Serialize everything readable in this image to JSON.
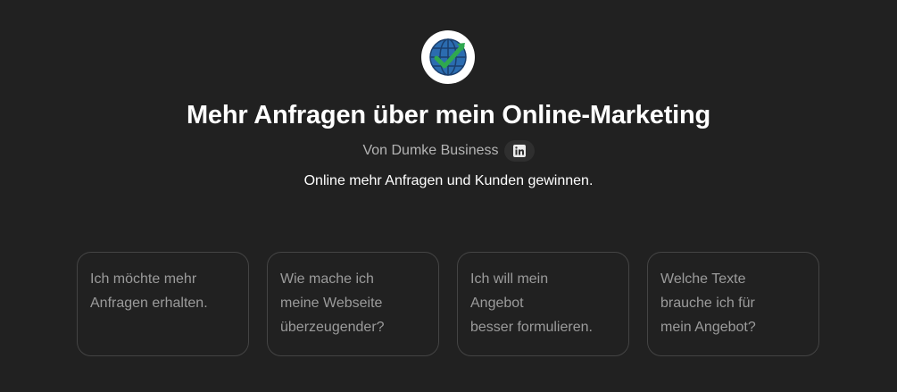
{
  "logo": {
    "icon": "globe-checkmark-icon",
    "colors": {
      "globe": "#2b6cb0",
      "check": "#2fa84f",
      "background": "#ffffff"
    }
  },
  "header": {
    "title": "Mehr Anfragen über mein Online-Marketing",
    "byline": "Von Dumke Business",
    "social_icon": "linkedin-icon",
    "description": "Online mehr Anfragen und Kunden gewinnen."
  },
  "conversation_starters": [
    {
      "lines": [
        "Ich möchte mehr",
        "Anfragen erhalten."
      ]
    },
    {
      "lines": [
        "Wie mache ich",
        "meine Webseite",
        "überzeugender?"
      ]
    },
    {
      "lines": [
        "Ich will mein",
        "Angebot",
        "besser formulieren."
      ]
    },
    {
      "lines": [
        "Welche Texte",
        "brauche ich für",
        "mein Angebot?"
      ]
    }
  ],
  "theme": {
    "background": "#212121",
    "text_primary": "#ffffff",
    "text_secondary": "#b4b4b4",
    "card_border": "#444444"
  }
}
